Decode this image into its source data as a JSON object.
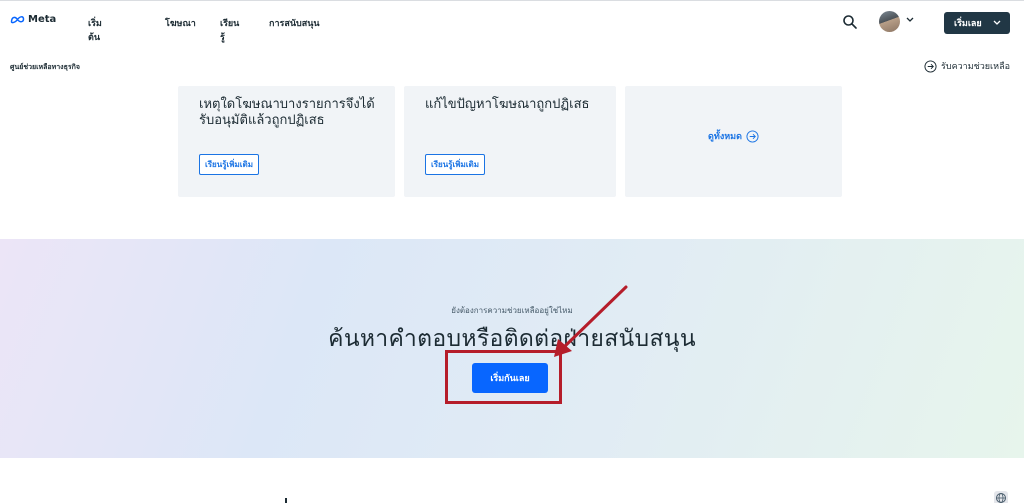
{
  "nav": {
    "logo_text": "Meta",
    "links": [
      "เริ่มต้นใช้งาน",
      "โฆษณา",
      "เรียนรู้",
      "การสนับสนุน"
    ],
    "start_button": "เริ่มเลย"
  },
  "subbar": {
    "breadcrumb": "ศูนย์ช่วยเหลือทางธุรกิจ",
    "help_link": "รับความช่วยเหลือ"
  },
  "cards": [
    {
      "title": "เหตุใดโฆษณาบางรายการจึงได้รับอนุมัติแล้วถูกปฏิเสธ",
      "button": "เรียนรู้เพิ่มเติม"
    },
    {
      "title": "แก้ไขปัญหาโฆษณาถูกปฏิเสธ",
      "button": "เรียนรู้เพิ่มเติม"
    },
    {
      "see_all": "ดูทั้งหมด"
    }
  ],
  "hero": {
    "subtitle": "ยังต้องการความช่วยเหลืออยู่ใช่ไหม",
    "title": "ค้นหาคำตอบหรือติดต่อฝ่ายสนับสนุน",
    "button": "เริ่มกันเลย"
  },
  "colors": {
    "primary": "#0866ff",
    "dark_button": "#213745",
    "card_bg": "#f1f4f7",
    "annotation": "#b51d2a"
  }
}
